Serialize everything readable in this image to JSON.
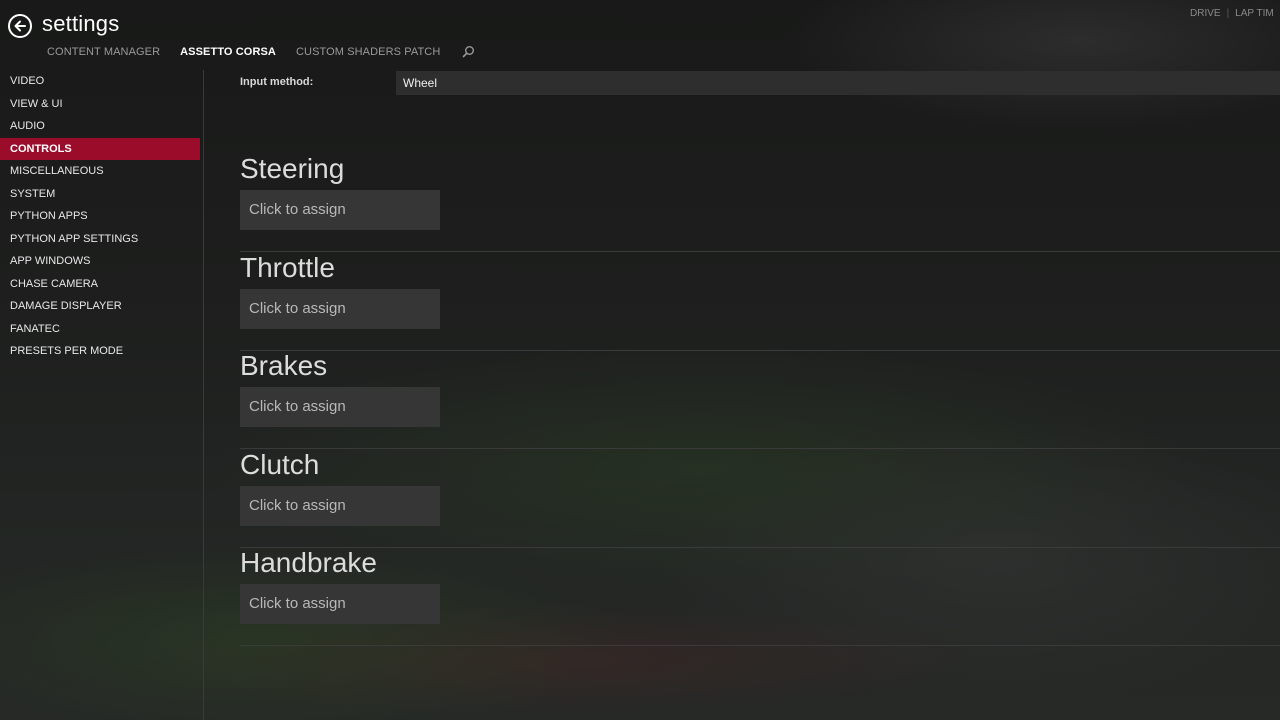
{
  "header": {
    "title": "settings",
    "tabs": [
      {
        "label": "CONTENT MANAGER"
      },
      {
        "label": "ASSETTO CORSA"
      },
      {
        "label": "CUSTOM SHADERS PATCH"
      }
    ],
    "active_tab": "ASSETTO CORSA",
    "right_links": [
      "DRIVE",
      "LAP TIM"
    ]
  },
  "sidebar": {
    "items": [
      {
        "label": "VIDEO"
      },
      {
        "label": "VIEW & UI"
      },
      {
        "label": "AUDIO"
      },
      {
        "label": "CONTROLS"
      },
      {
        "label": "MISCELLANEOUS"
      },
      {
        "label": "SYSTEM"
      },
      {
        "label": "PYTHON APPS"
      },
      {
        "label": "PYTHON APP SETTINGS"
      },
      {
        "label": "APP WINDOWS"
      },
      {
        "label": "CHASE CAMERA"
      },
      {
        "label": "DAMAGE DISPLAYER"
      },
      {
        "label": "FANATEC"
      },
      {
        "label": "PRESETS PER MODE"
      }
    ],
    "active_item": "CONTROLS"
  },
  "controls": {
    "input_method_label": "Input method:",
    "input_method_value": "Wheel",
    "sections": [
      {
        "title": "Steering",
        "button": "Click to assign"
      },
      {
        "title": "Throttle",
        "button": "Click to assign"
      },
      {
        "title": "Brakes",
        "button": "Click to assign"
      },
      {
        "title": "Clutch",
        "button": "Click to assign"
      },
      {
        "title": "Handbrake",
        "button": "Click to assign"
      }
    ]
  },
  "colors": {
    "accent": "#9a0c2a",
    "button_bg": "#363636",
    "select_bg": "#2e2e2e"
  },
  "icons": [
    "back-arrow-icon",
    "search-icon"
  ]
}
